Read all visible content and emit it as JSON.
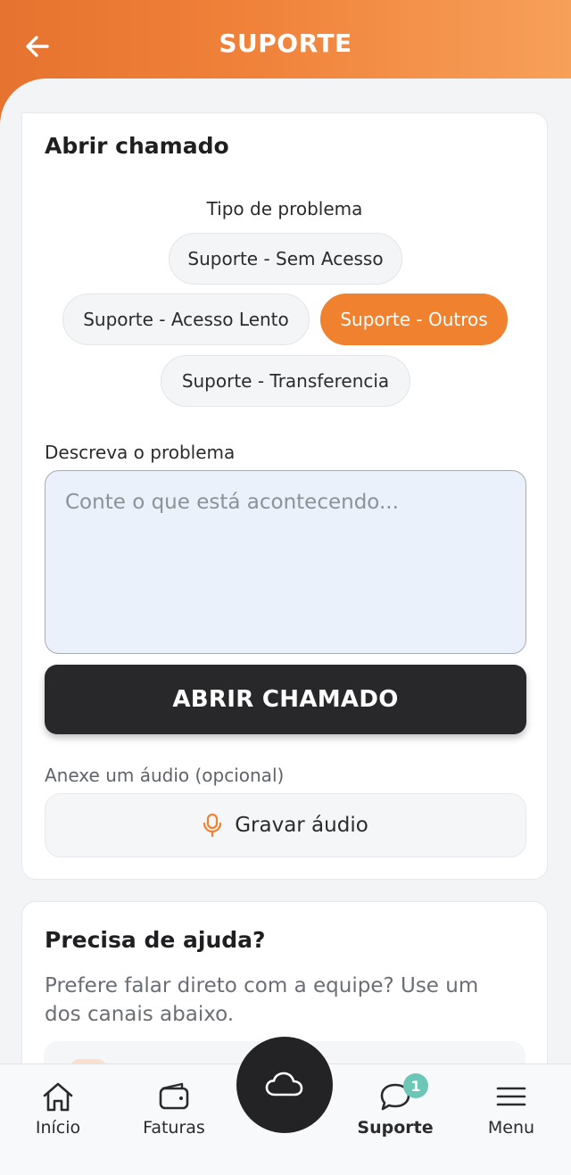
{
  "header": {
    "title": "SUPORTE"
  },
  "ticket_form": {
    "title": "Abrir chamado",
    "problem_type_label": "Tipo de problema",
    "problem_types": [
      {
        "label": "Suporte - Sem Acesso",
        "selected": false
      },
      {
        "label": "Suporte - Acesso Lento",
        "selected": false
      },
      {
        "label": "Suporte - Outros",
        "selected": true
      },
      {
        "label": "Suporte - Transferencia",
        "selected": false
      }
    ],
    "description_label": "Descreva o problema",
    "description_placeholder": "Conte o que está acontecendo...",
    "description_value": "",
    "submit_label": "ABRIR CHAMADO",
    "audio_label": "Anexe um áudio (opcional)",
    "record_label": "Gravar áudio"
  },
  "help": {
    "title": "Precisa de ajuda?",
    "text": "Prefere falar direto com a equipe? Use um dos canais abaixo."
  },
  "bottom_nav": {
    "items": [
      {
        "label": "Início",
        "icon": "home-icon"
      },
      {
        "label": "Faturas",
        "icon": "wallet-icon"
      },
      {
        "label": "Suporte",
        "icon": "chat-icon",
        "badge": "1",
        "active": true
      },
      {
        "label": "Menu",
        "icon": "menu-icon"
      }
    ],
    "center_icon": "cloud-icon"
  },
  "colors": {
    "accent": "#f0812f",
    "header_gradient_start": "#e6732f",
    "header_gradient_end": "#f7a05a",
    "dark_button": "#28282b",
    "badge": "#6cc7b6"
  }
}
